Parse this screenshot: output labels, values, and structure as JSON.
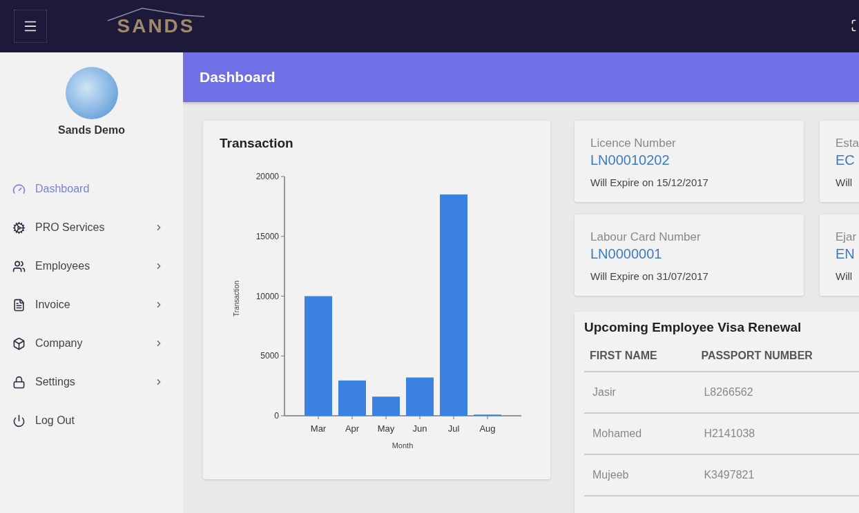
{
  "topbar": {
    "logo": "SANDS"
  },
  "sidebar": {
    "user": "Sands Demo",
    "items": [
      {
        "label": "Dashboard",
        "kind": "dashboard",
        "selected": true,
        "submenu": false
      },
      {
        "label": "PRO Services",
        "kind": "gears",
        "selected": false,
        "submenu": true
      },
      {
        "label": "Employees",
        "kind": "users",
        "selected": false,
        "submenu": true
      },
      {
        "label": "Invoice",
        "kind": "file",
        "selected": false,
        "submenu": true
      },
      {
        "label": "Company",
        "kind": "cube",
        "selected": false,
        "submenu": true
      },
      {
        "label": "Settings",
        "kind": "lock",
        "selected": false,
        "submenu": true
      },
      {
        "label": "Log Out",
        "kind": "power",
        "selected": false,
        "submenu": false
      }
    ]
  },
  "page_header": {
    "title": "Dashboard"
  },
  "transaction_card": {
    "title": "Transaction",
    "chart_data": {
      "type": "bar",
      "xlabel": "Month",
      "ylabel": "Transaction",
      "categories": [
        "Mar",
        "Apr",
        "May",
        "Jun",
        "Jul",
        "Aug"
      ],
      "values": [
        10000,
        2950,
        1600,
        3200,
        18500,
        100
      ],
      "ylim": [
        0,
        20000
      ],
      "yticks": [
        0,
        5000,
        10000,
        15000,
        20000
      ]
    }
  },
  "info_cards": [
    {
      "label": "Licence Number",
      "value": "LN00010202",
      "note": "Will Expire on 15/12/2017"
    },
    {
      "label": "Esta",
      "value": "EC",
      "note": "Will"
    },
    {
      "label": "Labour Card Number",
      "value": "LN0000001",
      "note": "Will Expire on 31/07/2017"
    },
    {
      "label": "Ejar",
      "value": "EN",
      "note": "Will"
    }
  ],
  "visa_renewal": {
    "title": "Upcoming Employee Visa Renewal",
    "columns": [
      "FIRST NAME",
      "PASSPORT NUMBER"
    ],
    "rows": [
      [
        "Jasir",
        "L8266562"
      ],
      [
        "Mohamed",
        "H2141038"
      ],
      [
        "Mujeeb",
        "K3497821"
      ]
    ]
  }
}
